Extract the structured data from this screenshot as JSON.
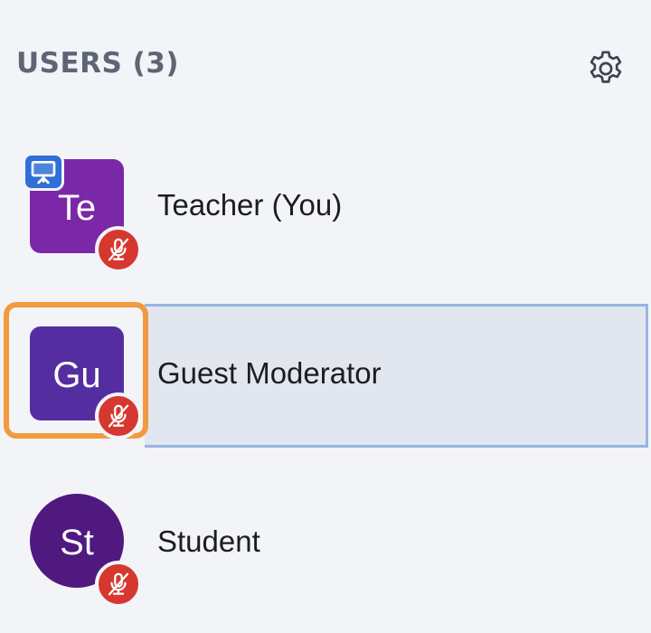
{
  "panel": {
    "title": "USERS (3)",
    "settings_icon": "gear-icon"
  },
  "users": [
    {
      "initials": "Te",
      "name": "Teacher (You)",
      "avatar_color": "#7a28a7",
      "avatar_shape": "rounded-square",
      "role_badge": "presenter-icon",
      "mic_status": "muted",
      "selected": false
    },
    {
      "initials": "Gu",
      "name": "Guest Moderator",
      "avatar_color": "#542ea1",
      "avatar_shape": "rounded-square",
      "mic_status": "muted",
      "selected": true
    },
    {
      "initials": "St",
      "name": "Student",
      "avatar_color": "#4f1980",
      "avatar_shape": "circle",
      "mic_status": "muted",
      "selected": false
    }
  ],
  "colors": {
    "background": "#f3f4f8",
    "header_text": "#5e6574",
    "mute_badge": "#d63830",
    "presenter_badge": "#2f6fd6",
    "focus_outline": "#f29a40",
    "selected_row_bg": "#e2e6ee",
    "selected_row_border": "#97b5e3"
  }
}
